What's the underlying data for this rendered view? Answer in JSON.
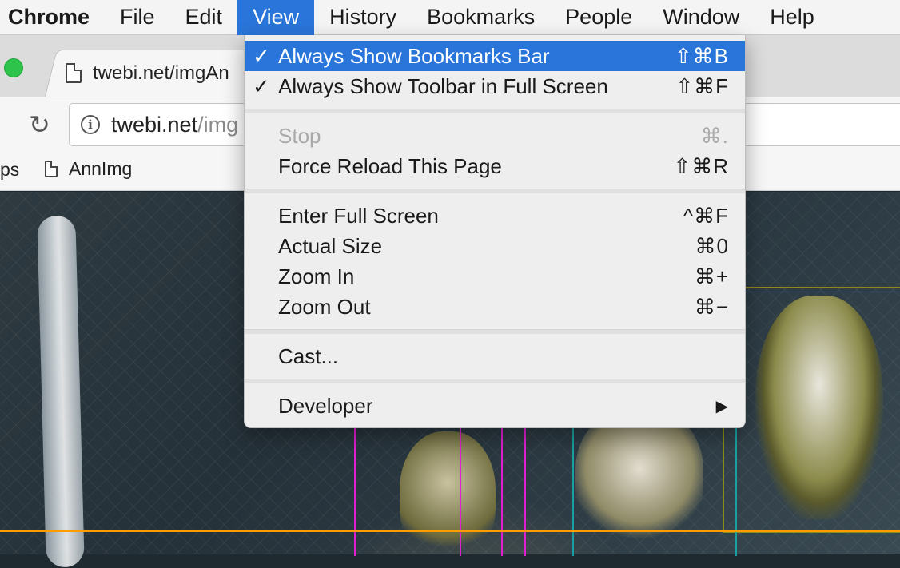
{
  "menubar": {
    "app": "Chrome",
    "items": [
      "File",
      "Edit",
      "View",
      "History",
      "Bookmarks",
      "People",
      "Window",
      "Help"
    ],
    "active": "View"
  },
  "tab": {
    "title": "twebi.net/imgAn"
  },
  "omnibox": {
    "host": "twebi.net",
    "path": "/img"
  },
  "bookmarks": {
    "apps_partial": "ps",
    "items": [
      "AnnImg"
    ]
  },
  "view_menu": {
    "items": [
      {
        "check": "✓",
        "label": "Always Show Bookmarks Bar",
        "shortcut": "⇧⌘B",
        "highlighted": true
      },
      {
        "check": "✓",
        "label": "Always Show Toolbar in Full Screen",
        "shortcut": "⇧⌘F"
      },
      {
        "label": "Stop",
        "shortcut": "⌘.",
        "disabled": true
      },
      {
        "label": "Force Reload This Page",
        "shortcut": "⇧⌘R"
      },
      {
        "label": "Enter Full Screen",
        "shortcut": "^⌘F"
      },
      {
        "label": "Actual Size",
        "shortcut": "⌘0"
      },
      {
        "label": "Zoom In",
        "shortcut": "⌘+"
      },
      {
        "label": "Zoom Out",
        "shortcut": "⌘−"
      },
      {
        "label": "Cast..."
      },
      {
        "label": "Developer",
        "submenu_arrow": "▶"
      }
    ]
  },
  "colors": {
    "highlight": "#2a75d9",
    "annotation_magenta": "#e020d0",
    "annotation_teal": "#1aa0a0",
    "annotation_orange": "#ff9c00",
    "annotation_olive": "#8e8a1a"
  }
}
